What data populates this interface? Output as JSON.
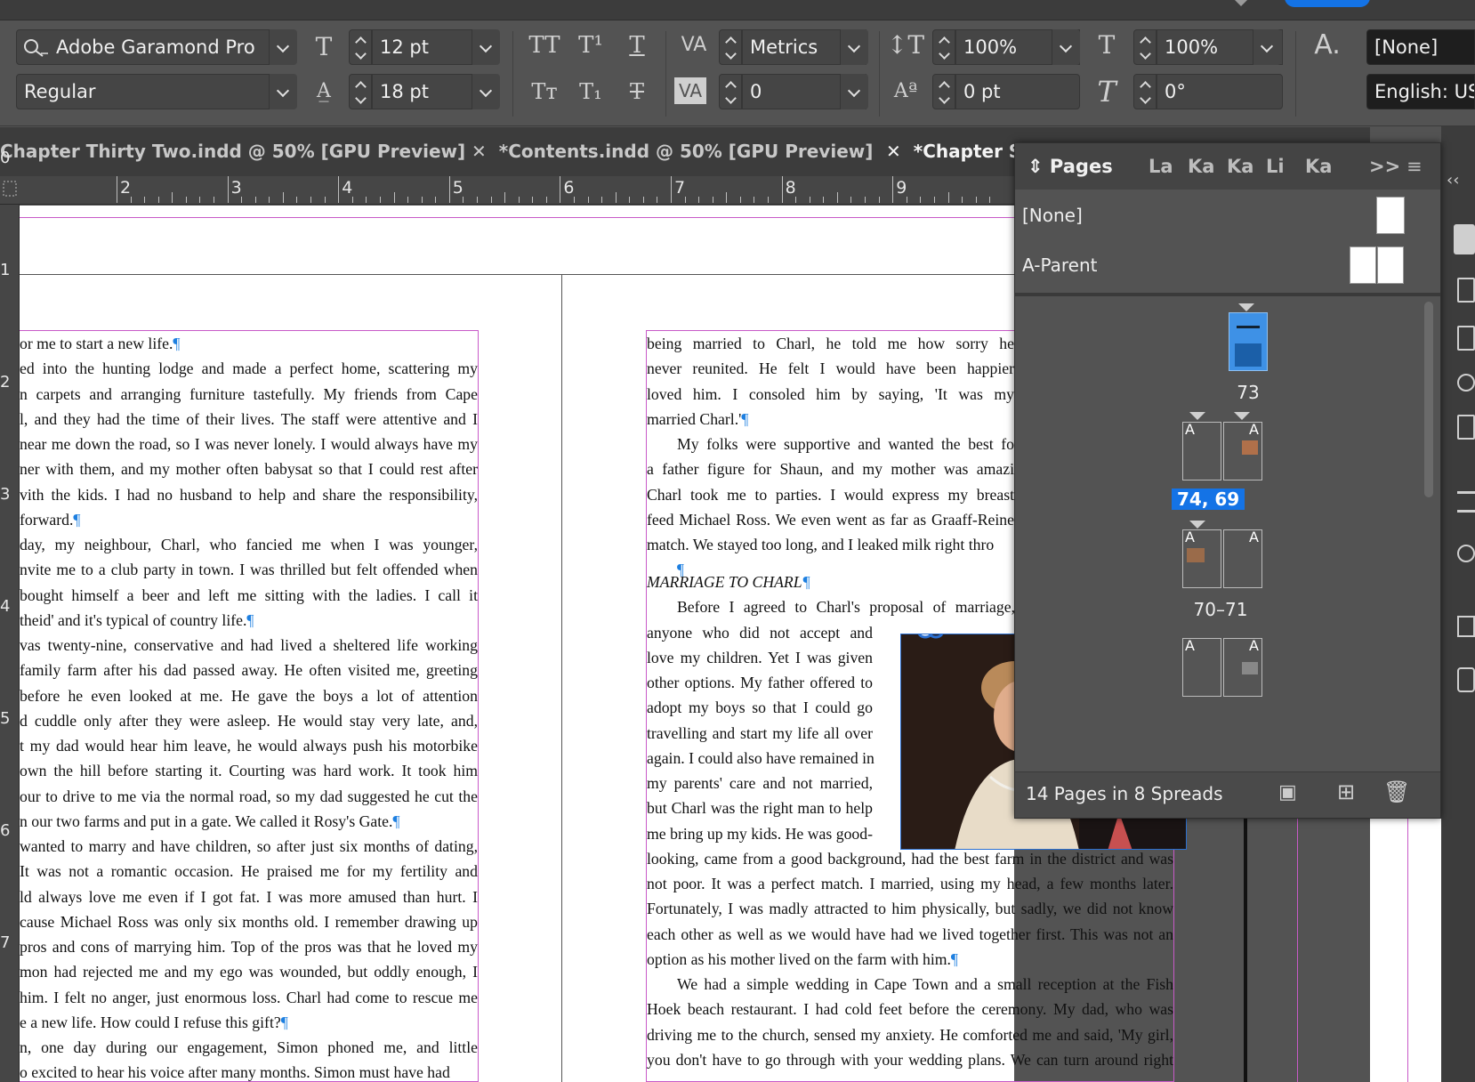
{
  "control_bar": {
    "font_family": "Adobe Garamond Pro",
    "font_style": "Regular",
    "font_size": "12 pt",
    "leading": "18 pt",
    "kerning": "Metrics",
    "tracking": "0",
    "vertical_scale": "100%",
    "horizontal_scale": "100%",
    "baseline_shift": "0 pt",
    "skew": "0°",
    "character_style": "[None]",
    "language": "English: USA"
  },
  "doc_tabs": [
    {
      "label": "Chapter Thirty Two.indd @ 50% [GPU Preview]"
    },
    {
      "label": "*Contents.indd @ 50% [GPU Preview]"
    },
    {
      "label": "*Chapter S"
    }
  ],
  "ruler": {
    "h_numbers": [
      "2",
      "3",
      "4",
      "5",
      "6",
      "7",
      "8",
      "9"
    ],
    "v_numbers": [
      "0",
      "1",
      "2",
      "3",
      "4",
      "5",
      "6",
      "7"
    ]
  },
  "left_page": {
    "paragraphs": [
      {
        "lines": [
          "or me to start a new life."
        ],
        "last": "¶"
      },
      {
        "lines": [
          "ed into the hunting lodge and made a perfect home, scattering my",
          "n carpets and arranging furniture tastefully. My friends from Cape",
          "l, and they had the time of their lives. The staff were attentive and I",
          "near me down the road, so I was never lonely. I would always have my",
          "ner with them, and my mother often babysat so that I could rest after",
          "vith the kids. I had no husband to help and share the responsibility,",
          "forward."
        ],
        "last": "¶"
      },
      {
        "lines": [
          "day, my neighbour, Charl, who fancied me when I was younger,",
          "nvite me to a club party in town. I was thrilled but felt offended when",
          "bought himself a beer and left me sitting with the ladies. I call it",
          "theid' and it's typical of country life."
        ],
        "last": "¶"
      },
      {
        "lines": [
          "vas twenty-nine, conservative and had lived a sheltered life working",
          "family farm after his dad passed away. He often visited me, greeting",
          "before he even looked at me. He gave the boys a lot of attention",
          "d cuddle only after they were asleep. He would stay very late, and,",
          "t my dad would hear him leave, he would always push his motorbike",
          "own the hill before starting it. Courting was hard work. It took him",
          "our to drive to me via the normal road, so my dad suggested he cut the",
          "n our two farms and put in a gate. We called it Rosy's Gate."
        ],
        "last": "¶"
      },
      {
        "lines": [
          "wanted to marry and have children, so after just six months of dating,",
          "It was not a romantic occasion. He praised me for my fertility and",
          "ld always love me even if I got fat. I was more amused than hurt. I",
          "cause Michael Ross was only six months old. I remember drawing up",
          "pros and cons of marrying him. Top of the pros was that he loved my",
          "mon had rejected me and my ego was wounded, but oddly enough, I",
          "him. I felt no anger, just enormous loss. Charl had come to rescue me",
          "e a new life. How could I refuse this gift?"
        ],
        "last": "¶"
      },
      {
        "lines": [
          "n, one day during our engagement, Simon phoned me, and little",
          "o excited to hear his voice after many months. Simon must have had"
        ],
        "last": ""
      }
    ]
  },
  "right_page": {
    "top_paragraphs": [
      {
        "lines": [
          "being married to Charl, he told me how sorry he",
          "never reunited. He felt I would have been happier",
          "loved him. I consoled him by saying, 'It was my",
          "married Charl.'"
        ],
        "last": "¶"
      },
      {
        "lines": [
          "My folks were supportive and wanted the best fo",
          "a father figure for Shaun, and my mother was amazi",
          "Charl took me to parties. I would express my breast",
          "feed Michael Ross. We even went as far as Graaff-Reine",
          "match. We stayed too long, and I leaked milk right thro"
        ],
        "last": ""
      },
      {
        "lines": [
          ""
        ],
        "last": "¶"
      }
    ],
    "heading": "MARRIAGE TO CHARL",
    "heading_mark": "¶",
    "first_line": "Before I agreed to Charl's proposal of marriage,",
    "wrapped_lines": [
      "anyone who did not accept and",
      "love my children. Yet I was given",
      "other options. My father offered to",
      "adopt my boys so that I could go",
      "travelling and start my life all over",
      "again. I could also have remained in",
      "my parents' care and not married,",
      "but Charl was the right man to help",
      "me bring up my kids. He was good-"
    ],
    "full_lines": [
      "looking, came from a good background, had the best farm in the district and was",
      "not poor. It was a perfect match. I married, using my head, a few months later.",
      "Fortunately, I was madly attracted to him physically, but sadly, we did not know",
      "each other as well as we would have had we lived together first. This was not an",
      "option as his mother lived on the farm with him."
    ],
    "full_last": "¶",
    "last_paragraph": [
      "We had a simple wedding in Cape Town and a small reception at the Fish",
      "Hoek beach restaurant. I had cold feet before the ceremony. My dad, who was",
      "driving me to the church, sensed my anxiety. He comforted me and said, 'My girl,",
      "you don't have to go through with your wedding plans. We can turn around right"
    ]
  },
  "pages_panel": {
    "title": "Pages",
    "other_tabs": [
      "La",
      "Ka",
      "Ka",
      "Li",
      "Ka"
    ],
    "overflow": ">>",
    "parents": [
      {
        "label": "[None]"
      },
      {
        "label": "A-Parent"
      }
    ],
    "spreads": [
      {
        "label": "73",
        "selected": false
      },
      {
        "label": "74, 69",
        "selected": true
      },
      {
        "label": "70–71",
        "selected": false
      }
    ],
    "thumb_letter": "A",
    "footer": "14 Pages in 8 Spreads"
  },
  "colors": {
    "accent": "#1473e6",
    "margin_guide": "#c85ac8",
    "selection": "#2a6fd1"
  }
}
